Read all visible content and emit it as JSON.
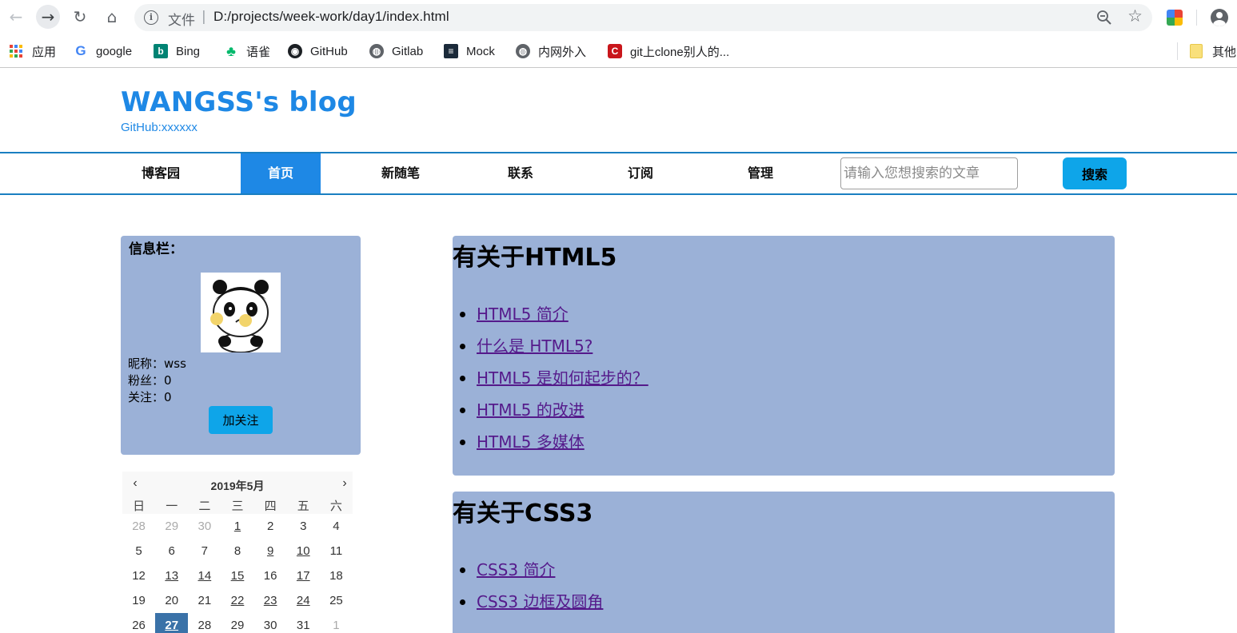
{
  "browser": {
    "omnibox_file_label": "文件",
    "omnibox_separator": "|",
    "url": "D:/projects/week-work/day1/index.html",
    "bookmarks": [
      {
        "label": "应用",
        "icon": "apps-icon"
      },
      {
        "label": "google",
        "icon": "google-icon"
      },
      {
        "label": "Bing",
        "icon": "bing-icon"
      },
      {
        "label": "语雀",
        "icon": "yuque-icon"
      },
      {
        "label": "GitHub",
        "icon": "github-icon"
      },
      {
        "label": "Gitlab",
        "icon": "globe-icon"
      },
      {
        "label": "Mock",
        "icon": "mock-icon"
      },
      {
        "label": "内网外入",
        "icon": "globe-icon"
      },
      {
        "label": "git上clone别人的...",
        "icon": "csdn-icon"
      }
    ],
    "other_bookmarks_label": "其他"
  },
  "blog": {
    "title": "WANGSS's blog",
    "subtitle": "GitHub:xxxxxx",
    "accent_color": "#1e88e5"
  },
  "nav": {
    "items": [
      "博客园",
      "首页",
      "新随笔",
      "联系",
      "订阅",
      "管理"
    ],
    "active_index": 1,
    "search_placeholder": "请输入您想搜索的文章",
    "search_button": "搜索"
  },
  "info": {
    "title": "信息栏：",
    "nickname": "昵称：wss",
    "fans": "粉丝：0",
    "following": "关注：0",
    "follow_button": "加关注"
  },
  "calendar": {
    "title": "2019年5月",
    "prev": "‹",
    "next": "›",
    "weekdays": [
      "日",
      "一",
      "二",
      "三",
      "四",
      "五",
      "六"
    ],
    "weeks": [
      [
        "28",
        "29",
        "30",
        "1",
        "2",
        "3",
        "4"
      ],
      [
        "5",
        "6",
        "7",
        "8",
        "9",
        "10",
        "11"
      ],
      [
        "12",
        "13",
        "14",
        "15",
        "16",
        "17",
        "18"
      ],
      [
        "19",
        "20",
        "21",
        "22",
        "23",
        "24",
        "25"
      ],
      [
        "26",
        "27",
        "28",
        "29",
        "30",
        "31",
        "1"
      ]
    ]
  },
  "articles": [
    {
      "title": "有关于HTML5",
      "links": [
        "HTML5 简介",
        "什么是 HTML5?",
        "HTML5 是如何起步的？",
        "HTML5 的改进",
        "HTML5 多媒体"
      ]
    },
    {
      "title": "有关于CSS3",
      "links": [
        "CSS3 简介",
        "CSS3 边框及圆角"
      ]
    }
  ]
}
